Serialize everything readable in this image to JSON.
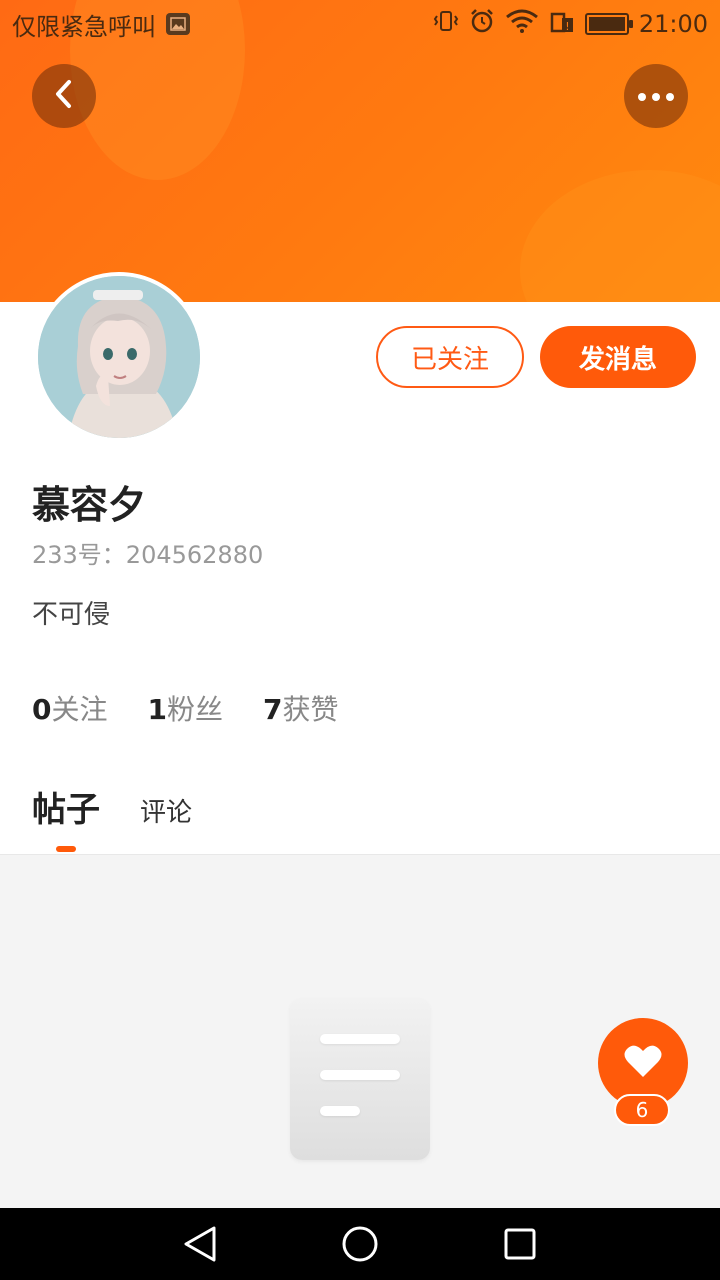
{
  "status_bar": {
    "left_text": "仅限紧急呼叫",
    "time": "21:00"
  },
  "header": {
    "back_icon": "chevron-left-icon",
    "more_icon": "more-horizontal-icon"
  },
  "profile": {
    "name": "慕容夕",
    "id_label": "233号：204562880",
    "bio": "不可侵",
    "follow_button": "已关注",
    "message_button": "发消息"
  },
  "stats": [
    {
      "num": "0",
      "label": "关注"
    },
    {
      "num": "1",
      "label": "粉丝"
    },
    {
      "num": "7",
      "label": "获赞"
    }
  ],
  "tabs": {
    "posts": "帖子",
    "comments": "评论"
  },
  "like_fab": {
    "count": "6",
    "icon": "heart-icon"
  },
  "colors": {
    "accent": "#ff5a0a",
    "header_gradient_start": "#ff6a14",
    "header_gradient_end": "#ff8a0e"
  }
}
